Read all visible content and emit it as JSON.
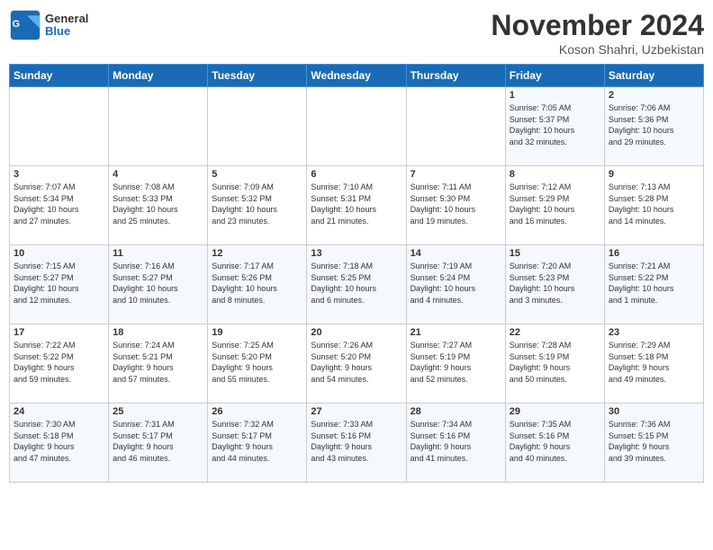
{
  "logo": {
    "line1": "General",
    "line2": "Blue"
  },
  "header": {
    "month": "November 2024",
    "location": "Koson Shahri, Uzbekistan"
  },
  "days_of_week": [
    "Sunday",
    "Monday",
    "Tuesday",
    "Wednesday",
    "Thursday",
    "Friday",
    "Saturday"
  ],
  "weeks": [
    [
      {
        "day": "",
        "info": ""
      },
      {
        "day": "",
        "info": ""
      },
      {
        "day": "",
        "info": ""
      },
      {
        "day": "",
        "info": ""
      },
      {
        "day": "",
        "info": ""
      },
      {
        "day": "1",
        "info": "Sunrise: 7:05 AM\nSunset: 5:37 PM\nDaylight: 10 hours\nand 32 minutes."
      },
      {
        "day": "2",
        "info": "Sunrise: 7:06 AM\nSunset: 5:36 PM\nDaylight: 10 hours\nand 29 minutes."
      }
    ],
    [
      {
        "day": "3",
        "info": "Sunrise: 7:07 AM\nSunset: 5:34 PM\nDaylight: 10 hours\nand 27 minutes."
      },
      {
        "day": "4",
        "info": "Sunrise: 7:08 AM\nSunset: 5:33 PM\nDaylight: 10 hours\nand 25 minutes."
      },
      {
        "day": "5",
        "info": "Sunrise: 7:09 AM\nSunset: 5:32 PM\nDaylight: 10 hours\nand 23 minutes."
      },
      {
        "day": "6",
        "info": "Sunrise: 7:10 AM\nSunset: 5:31 PM\nDaylight: 10 hours\nand 21 minutes."
      },
      {
        "day": "7",
        "info": "Sunrise: 7:11 AM\nSunset: 5:30 PM\nDaylight: 10 hours\nand 19 minutes."
      },
      {
        "day": "8",
        "info": "Sunrise: 7:12 AM\nSunset: 5:29 PM\nDaylight: 10 hours\nand 16 minutes."
      },
      {
        "day": "9",
        "info": "Sunrise: 7:13 AM\nSunset: 5:28 PM\nDaylight: 10 hours\nand 14 minutes."
      }
    ],
    [
      {
        "day": "10",
        "info": "Sunrise: 7:15 AM\nSunset: 5:27 PM\nDaylight: 10 hours\nand 12 minutes."
      },
      {
        "day": "11",
        "info": "Sunrise: 7:16 AM\nSunset: 5:27 PM\nDaylight: 10 hours\nand 10 minutes."
      },
      {
        "day": "12",
        "info": "Sunrise: 7:17 AM\nSunset: 5:26 PM\nDaylight: 10 hours\nand 8 minutes."
      },
      {
        "day": "13",
        "info": "Sunrise: 7:18 AM\nSunset: 5:25 PM\nDaylight: 10 hours\nand 6 minutes."
      },
      {
        "day": "14",
        "info": "Sunrise: 7:19 AM\nSunset: 5:24 PM\nDaylight: 10 hours\nand 4 minutes."
      },
      {
        "day": "15",
        "info": "Sunrise: 7:20 AM\nSunset: 5:23 PM\nDaylight: 10 hours\nand 3 minutes."
      },
      {
        "day": "16",
        "info": "Sunrise: 7:21 AM\nSunset: 5:22 PM\nDaylight: 10 hours\nand 1 minute."
      }
    ],
    [
      {
        "day": "17",
        "info": "Sunrise: 7:22 AM\nSunset: 5:22 PM\nDaylight: 9 hours\nand 59 minutes."
      },
      {
        "day": "18",
        "info": "Sunrise: 7:24 AM\nSunset: 5:21 PM\nDaylight: 9 hours\nand 57 minutes."
      },
      {
        "day": "19",
        "info": "Sunrise: 7:25 AM\nSunset: 5:20 PM\nDaylight: 9 hours\nand 55 minutes."
      },
      {
        "day": "20",
        "info": "Sunrise: 7:26 AM\nSunset: 5:20 PM\nDaylight: 9 hours\nand 54 minutes."
      },
      {
        "day": "21",
        "info": "Sunrise: 7:27 AM\nSunset: 5:19 PM\nDaylight: 9 hours\nand 52 minutes."
      },
      {
        "day": "22",
        "info": "Sunrise: 7:28 AM\nSunset: 5:19 PM\nDaylight: 9 hours\nand 50 minutes."
      },
      {
        "day": "23",
        "info": "Sunrise: 7:29 AM\nSunset: 5:18 PM\nDaylight: 9 hours\nand 49 minutes."
      }
    ],
    [
      {
        "day": "24",
        "info": "Sunrise: 7:30 AM\nSunset: 5:18 PM\nDaylight: 9 hours\nand 47 minutes."
      },
      {
        "day": "25",
        "info": "Sunrise: 7:31 AM\nSunset: 5:17 PM\nDaylight: 9 hours\nand 46 minutes."
      },
      {
        "day": "26",
        "info": "Sunrise: 7:32 AM\nSunset: 5:17 PM\nDaylight: 9 hours\nand 44 minutes."
      },
      {
        "day": "27",
        "info": "Sunrise: 7:33 AM\nSunset: 5:16 PM\nDaylight: 9 hours\nand 43 minutes."
      },
      {
        "day": "28",
        "info": "Sunrise: 7:34 AM\nSunset: 5:16 PM\nDaylight: 9 hours\nand 41 minutes."
      },
      {
        "day": "29",
        "info": "Sunrise: 7:35 AM\nSunset: 5:16 PM\nDaylight: 9 hours\nand 40 minutes."
      },
      {
        "day": "30",
        "info": "Sunrise: 7:36 AM\nSunset: 5:15 PM\nDaylight: 9 hours\nand 39 minutes."
      }
    ]
  ]
}
